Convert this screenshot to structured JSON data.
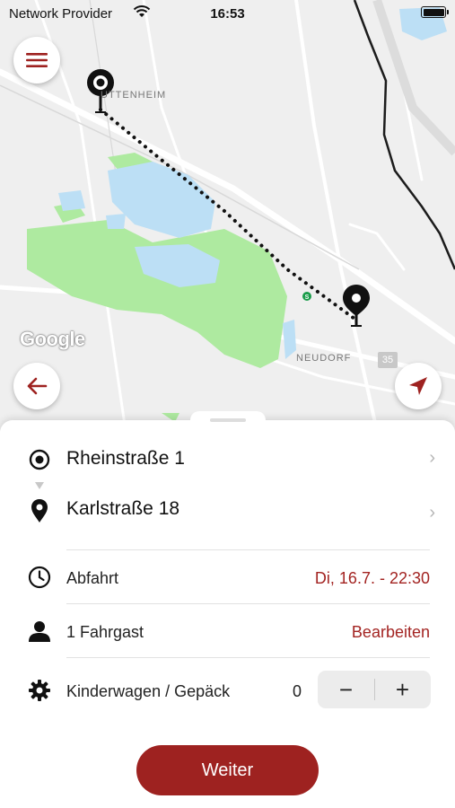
{
  "status_bar": {
    "carrier": "Network Provider",
    "time": "16:53"
  },
  "map": {
    "labels": {
      "town_top": "UTTENHEIM",
      "town_bottom": "NEUDORF",
      "road_number": "35"
    },
    "attribution": "Google"
  },
  "route": {
    "origin": "Rheinstraße 1",
    "destination": "Karlstraße 18"
  },
  "departure": {
    "label": "Abfahrt",
    "value": "Di, 16.7. - 22:30"
  },
  "passengers": {
    "label": "1 Fahrgast",
    "action": "Bearbeiten"
  },
  "luggage": {
    "label": "Kinderwagen / Gepäck",
    "count": "0",
    "minus": "−",
    "plus": "+"
  },
  "primary_button": {
    "label": "Weiter"
  },
  "colors": {
    "accent": "#9e2220",
    "accent_text": "#a32422",
    "park": "#aeeaa0",
    "water": "#bcdff5"
  }
}
